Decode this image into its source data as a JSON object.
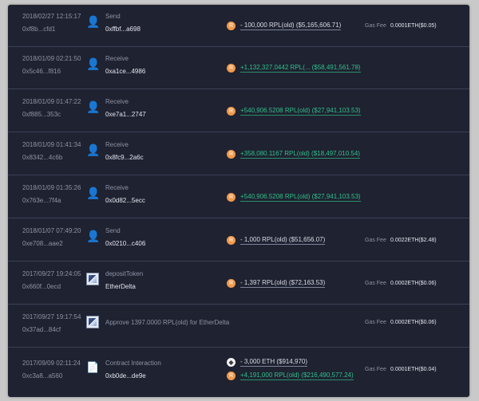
{
  "colors": {
    "background": "#1f2231",
    "positive": "#2fc089",
    "coin": "#f09a4c",
    "muted": "#8d93a4"
  },
  "transactions": [
    {
      "date": "2018/02/27 12:15:17",
      "hash": "0xf8b...cfd1",
      "icon": "user-icon",
      "type": "Send",
      "address": "0xffbf...a698",
      "amounts": [
        {
          "coin": "rpl",
          "text": "- 100,000 RPL(old)   ($5,165,606.71)",
          "positive": false
        }
      ],
      "fee_label": "Gas Fee",
      "fee": "0.0001ETH($0.05)"
    },
    {
      "date": "2018/01/09 02:21:50",
      "hash": "0x5c46...f816",
      "icon": "user-icon",
      "type": "Receive",
      "address": "0xa1ce...4986",
      "amounts": [
        {
          "coin": "rpl",
          "text": "+1,132,327.0442 RPL(...   ($58,491,561.78)",
          "positive": true
        }
      ]
    },
    {
      "date": "2018/01/09 01:47:22",
      "hash": "0xf885...353c",
      "icon": "user-icon",
      "type": "Receive",
      "address": "0xe7a1...2747",
      "amounts": [
        {
          "coin": "rpl",
          "text": "+540,906.5208 RPL(old)   ($27,941,103.53)",
          "positive": true
        }
      ]
    },
    {
      "date": "2018/01/09 01:41:34",
      "hash": "0x8342...4c6b",
      "icon": "user-icon",
      "type": "Receive",
      "address": "0x8fc9...2a6c",
      "amounts": [
        {
          "coin": "rpl",
          "text": "+358,080.1167 RPL(old)   ($18,497,010.54)",
          "positive": true
        }
      ]
    },
    {
      "date": "2018/01/09 01:35:26",
      "hash": "0x763e...7f4a",
      "icon": "user-icon",
      "type": "Receive",
      "address": "0x0d82...5ecc",
      "amounts": [
        {
          "coin": "rpl",
          "text": "+540,906.5208 RPL(old)   ($27,941,103.53)",
          "positive": true
        }
      ]
    },
    {
      "date": "2018/01/07 07:49:20",
      "hash": "0xe708...aae2",
      "icon": "user-icon",
      "type": "Send",
      "address": "0x0210...c406",
      "amounts": [
        {
          "coin": "rpl",
          "text": "- 1,000 RPL(old)   ($51,656.07)",
          "positive": false
        }
      ],
      "fee_label": "Gas Fee",
      "fee": "0.0022ETH($2.48)"
    },
    {
      "date": "2017/09/27 19:24:05",
      "hash": "0x660f...0ecd",
      "icon": "etherdelta-logo-icon",
      "type": "depositToken",
      "address": "EtherDelta",
      "amounts": [
        {
          "coin": "rpl",
          "text": "- 1,397 RPL(old)   ($72,163.53)",
          "positive": false
        }
      ],
      "fee_label": "Gas Fee",
      "fee": "0.0002ETH($0.06)"
    },
    {
      "date": "2017/09/27 19:17:54",
      "hash": "0x37ad...84cf",
      "icon": "etherdelta-logo-icon",
      "type": "Approve 1397.0000 RPL(old) for EtherDelta",
      "address": "",
      "amounts": [],
      "fee_label": "Gas Fee",
      "fee": "0.0002ETH($0.06)"
    },
    {
      "date": "2017/09/09 02:11:24",
      "hash": "0xc3a8...a560",
      "icon": "document-icon",
      "type": "Contract Interaction",
      "address": "0xb0de...de9e",
      "amounts": [
        {
          "coin": "eth",
          "text": "- 3,000 ETH   ($914,970)",
          "positive": false
        },
        {
          "coin": "rpl",
          "text": "+4,191,000 RPL(old)   ($216,490,577.24)",
          "positive": true
        }
      ],
      "fee_label": "Gas Fee",
      "fee": "0.0001ETH($0.04)"
    }
  ]
}
